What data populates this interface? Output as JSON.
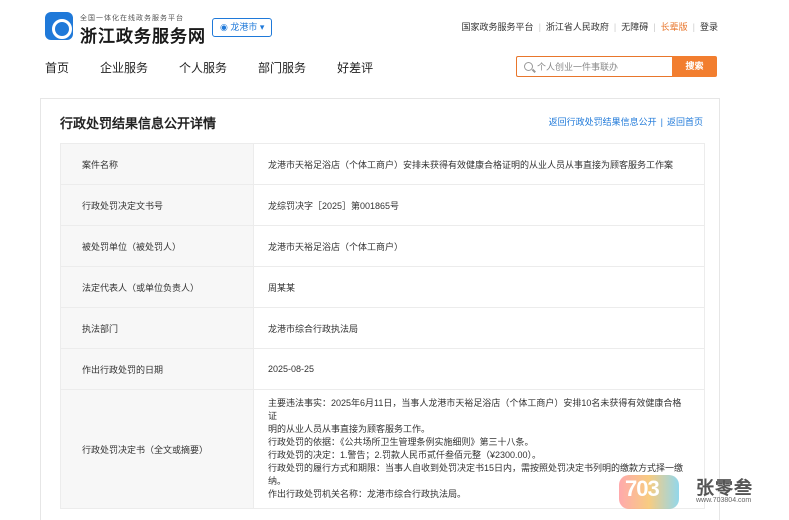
{
  "header": {
    "logo_subtitle": "全国一体化在线政务服务平台",
    "logo_title": "浙江政务服务网",
    "city": "龙港市",
    "toplinks": [
      "国家政务服务平台",
      "浙江省人民政府",
      "无障碍",
      "长辈版",
      "登录"
    ]
  },
  "nav": {
    "items": [
      "首页",
      "企业服务",
      "个人服务",
      "部门服务",
      "好差评"
    ]
  },
  "search": {
    "placeholder": "个人创业一件事联办",
    "button": "搜索"
  },
  "panel": {
    "title": "行政处罚结果信息公开详情",
    "link_back_list": "返回行政处罚结果信息公开",
    "link_home": "返回首页"
  },
  "rows": [
    {
      "key": "案件名称",
      "value": "龙港市天裕足浴店（个体工商户）安排未获得有效健康合格证明的从业人员从事直接为顾客服务工作案"
    },
    {
      "key": "行政处罚决定文书号",
      "value": "龙综罚决字［2025］第001865号"
    },
    {
      "key": "被处罚单位（被处罚人）",
      "value": "龙港市天裕足浴店（个体工商户）"
    },
    {
      "key": "法定代表人（或单位负责人）",
      "value": "周某某"
    },
    {
      "key": "执法部门",
      "value": "龙港市综合行政执法局"
    },
    {
      "key": "作出行政处罚的日期",
      "value": "2025-08-25"
    }
  ],
  "decision": {
    "key": "行政处罚决定书（全文或摘要）",
    "lines": [
      "主要违法事实：2025年6月11日，当事人龙港市天裕足浴店（个体工商户）安排10名未获得有效健康合格证",
      "明的从业人员从事直接为顾客服务工作。",
      "行政处罚的依据：《公共场所卫生管理条例实施细则》第三十八条。",
      "行政处罚的决定：1.警告；2.罚款人民币贰仟叁佰元整（¥2300.00）。",
      "行政处罚的履行方式和期限：当事人自收到处罚决定书15日内，需按照处罚决定书列明的缴款方式择一缴",
      "纳。",
      "作出行政处罚机关名称：龙港市综合行政执法局。"
    ]
  },
  "watermark": {
    "digits": "703",
    "name": "张零叁",
    "url": "www.703804.com"
  }
}
